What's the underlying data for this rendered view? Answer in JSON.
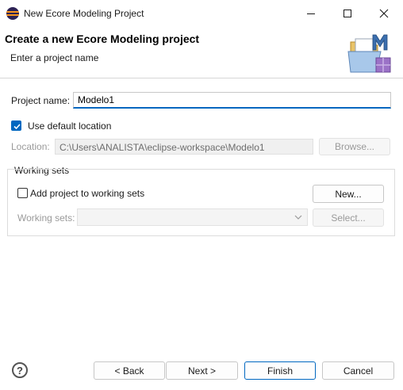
{
  "window": {
    "title": "New Ecore Modeling Project",
    "app_icon": "eclipse-icon",
    "controls": [
      "minimize-icon",
      "maximize-icon",
      "close-icon"
    ]
  },
  "banner": {
    "title": "Create a new Ecore Modeling project",
    "subtitle": "Enter a project name",
    "icon": "ecore-project-wizard-icon"
  },
  "form": {
    "project_name_label": "Project name:",
    "project_name_value": "Modelo1",
    "use_default_location_label": "Use default location",
    "use_default_location_checked": true,
    "location_label": "Location:",
    "location_value": "C:\\Users\\ANALISTA\\eclipse-workspace\\Modelo1",
    "browse_label": "Browse..."
  },
  "working_sets": {
    "group_label": "Working sets",
    "add_label": "Add project to working sets",
    "add_checked": false,
    "new_label": "New...",
    "sets_label": "Working sets:",
    "sets_value": "",
    "select_label": "Select..."
  },
  "footer": {
    "help_icon": "help-icon",
    "back_label": "< Back",
    "next_label": "Next >",
    "finish_label": "Finish",
    "cancel_label": "Cancel"
  },
  "colors": {
    "accent": "#0067c0",
    "disabled_text": "#9a9a9a"
  }
}
